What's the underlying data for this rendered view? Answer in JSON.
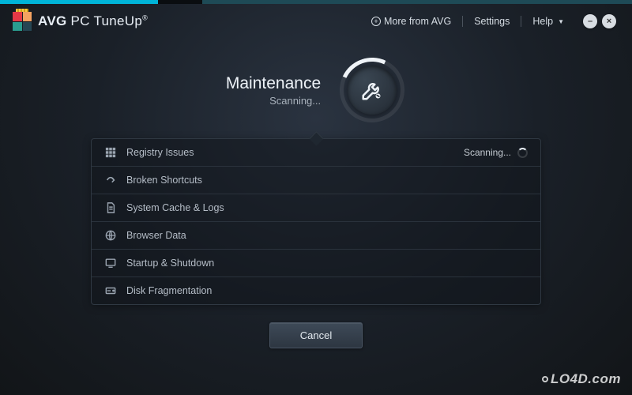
{
  "brand": {
    "prefix": "AVG",
    "name": "PC TuneUp",
    "reg": "®"
  },
  "header": {
    "more": "More from AVG",
    "settings": "Settings",
    "help": "Help"
  },
  "scan": {
    "title": "Maintenance",
    "subtitle": "Scanning..."
  },
  "rows": [
    {
      "label": "Registry Issues",
      "status": "Scanning..."
    },
    {
      "label": "Broken Shortcuts",
      "status": ""
    },
    {
      "label": "System Cache & Logs",
      "status": ""
    },
    {
      "label": "Browser Data",
      "status": ""
    },
    {
      "label": "Startup & Shutdown",
      "status": ""
    },
    {
      "label": "Disk Fragmentation",
      "status": ""
    }
  ],
  "buttons": {
    "cancel": "Cancel"
  },
  "watermark": "LO4D.com"
}
